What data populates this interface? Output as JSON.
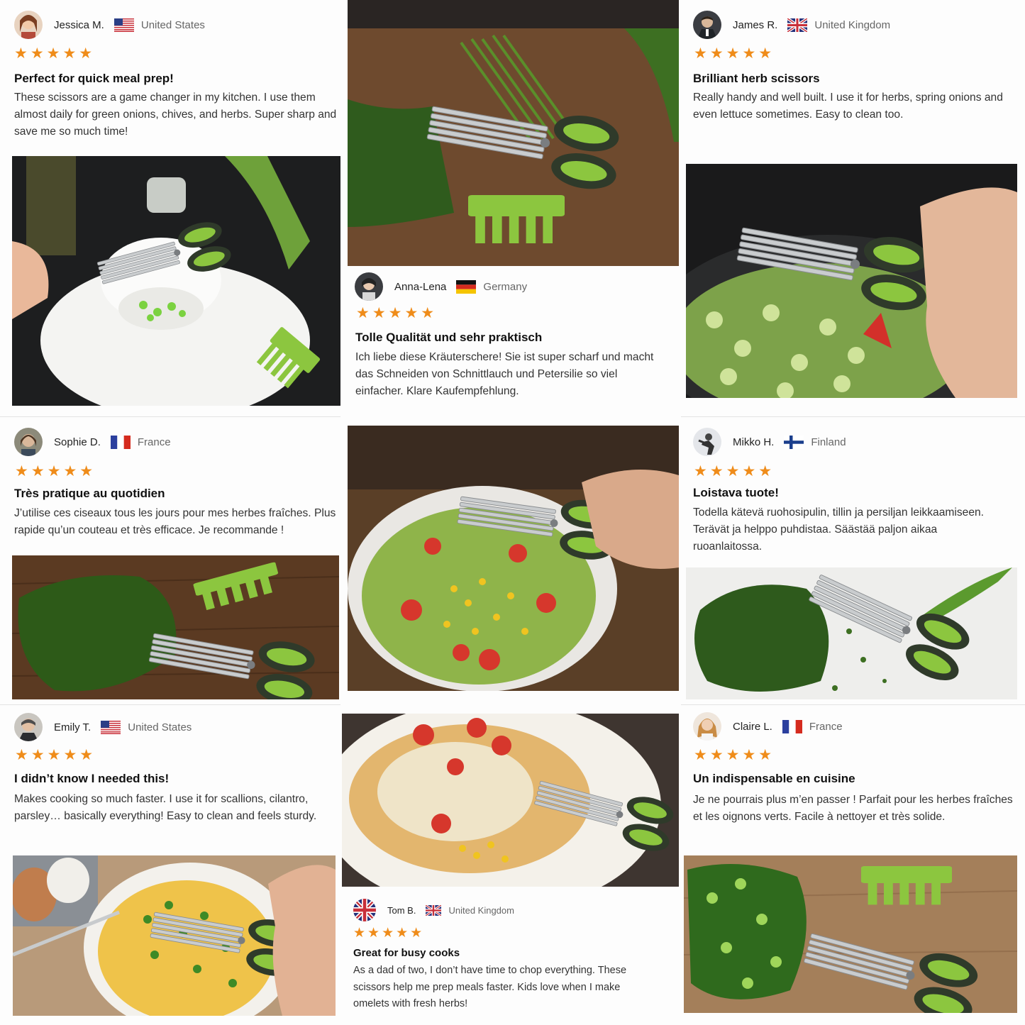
{
  "stars": "★★★★★",
  "reviews": [
    {
      "name": "Jessica M.",
      "country": "United States",
      "title": "Perfect for quick meal prep!",
      "text": "These scissors are a game changer in my kitchen. I use them almost daily for green onions, chives, and herbs. Super sharp and save me so much time!"
    },
    {
      "name": "James R.",
      "country": "United Kingdom",
      "title": "Brilliant herb scissors",
      "text": "Really handy and well built. I use it for herbs, spring onions and even lettuce sometimes. Easy to clean too."
    },
    {
      "name": "Anna-Lena",
      "country": "Germany",
      "title": "Tolle Qualität und sehr praktisch",
      "text": "Ich liebe diese Kräuterschere! Sie ist super scharf und macht das Schneiden von Schnittlauch und Petersilie so viel einfacher. Klare Kaufempfehlung."
    },
    {
      "name": "Sophie D.",
      "country": "France",
      "title": "Très pratique au quotidien",
      "text": "J’utilise ces ciseaux tous les jours pour mes herbes fraîches. Plus rapide qu’un couteau et très efficace. Je recommande !"
    },
    {
      "name": "Mikko H.",
      "country": "Finland",
      "title": "Loistava tuote!",
      "text": "Todella kätevä ruohosipulin, tillin ja persiljan leikkaamiseen. Terävät ja helppo puhdistaa. Säästää paljon aikaa ruoanlaitossa."
    },
    {
      "name": "Emily T.",
      "country": "United States",
      "title": "I didn’t know I needed this!",
      "text": "Makes cooking so much faster. I use it for scallions, cilantro, parsley… basically everything! Easy to clean and feels sturdy."
    },
    {
      "name": "Claire L.",
      "country": "France",
      "title": "Un indispensable en cuisine",
      "text": "Je ne pourrais plus m’en passer ! Parfait pour les herbes fraîches et les oignons verts. Facile à nettoyer et très solide."
    },
    {
      "name": "Tom B.",
      "country": "United Kingdom",
      "title": "Great for busy cooks",
      "text": "As a dad of two, I don’t have time to chop everything. These scissors help me prep meals faster. Kids love when I make omelets with fresh herbs!"
    }
  ],
  "colors": {
    "star": "#ef8c1a",
    "scissor_green": "#8cc63f",
    "handle_dark": "#2f3a2a"
  }
}
